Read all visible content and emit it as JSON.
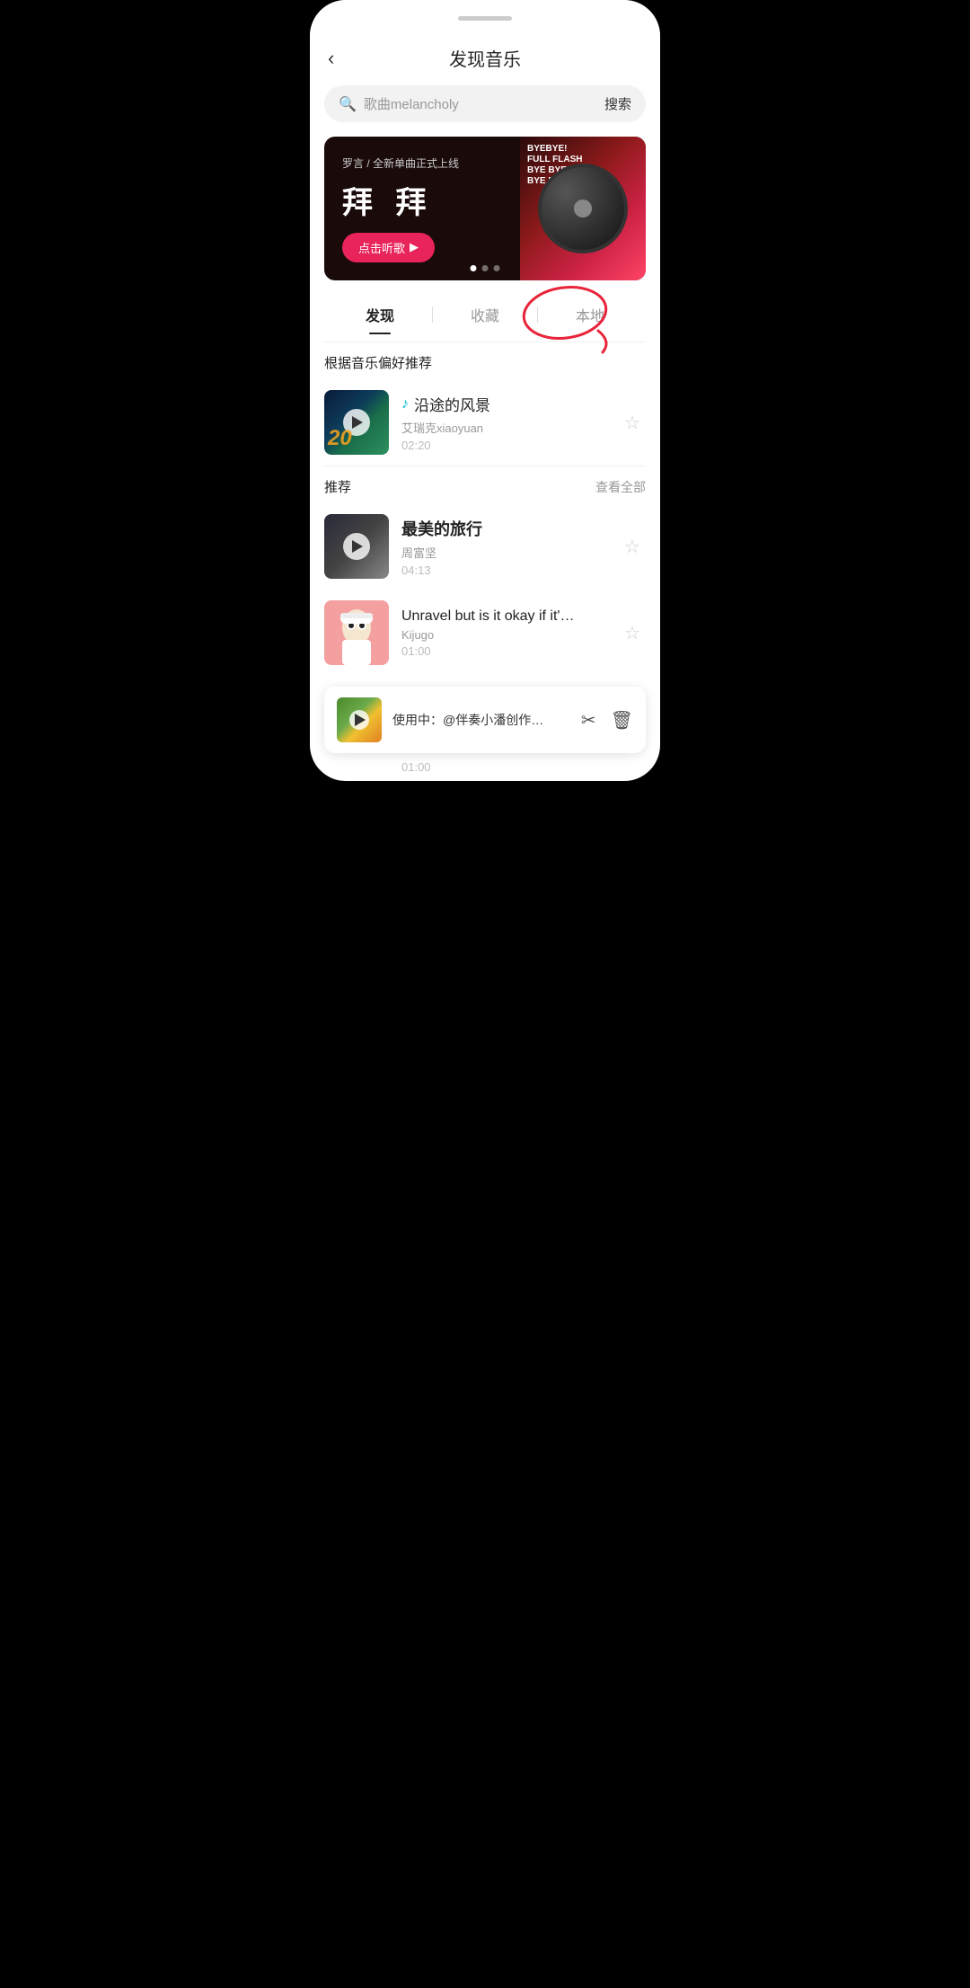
{
  "app": {
    "title": "发现音乐",
    "back_label": "‹"
  },
  "search": {
    "placeholder": "歌曲melancholy",
    "button_label": "搜索"
  },
  "banner": {
    "subtitle": "罗言 / 全新单曲正式上线",
    "title": "拜 拜",
    "listen_btn": "点击听歌",
    "dots": [
      true,
      false,
      false
    ]
  },
  "tabs": [
    {
      "label": "发现",
      "active": true
    },
    {
      "label": "收藏",
      "active": false
    },
    {
      "label": "本地",
      "active": false,
      "circled": true
    }
  ],
  "recommendation_section": {
    "title": "根据音乐偏好推荐",
    "songs": [
      {
        "name": "沿途的风景",
        "artist": "艾瑞克xiaoyuan",
        "duration": "02:20",
        "has_music_note": true
      }
    ]
  },
  "recommend_section": {
    "title": "推荐",
    "see_all": "查看全部",
    "songs": [
      {
        "name": "最美的旅行",
        "artist": "周富坚",
        "duration": "04:13"
      },
      {
        "name": "Unravel but is it okay if it'…",
        "artist": "Kijugo",
        "duration": "01:00"
      }
    ]
  },
  "now_playing": {
    "text": "使用中：@伴奏小潘创作…",
    "duration": "01:00",
    "scissors_icon": "✂",
    "delete_icon": "🗑"
  }
}
